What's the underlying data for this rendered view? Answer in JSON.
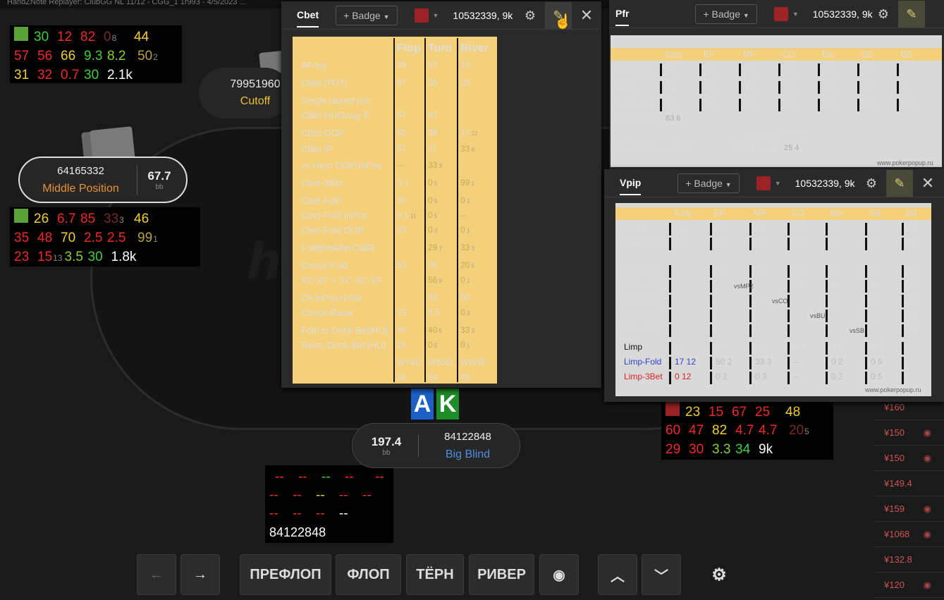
{
  "window_title": "HandZNote Replayer: ClubGG NL 11/12 - CGG_1 1r993 - 4/5/2023 ...",
  "watermark": "h",
  "hud_topleft": {
    "rows": [
      [
        {
          "t": "",
          "k": "sq"
        },
        {
          "t": "30",
          "c": "cG"
        },
        {
          "t": "12",
          "c": "cR"
        },
        {
          "t": "82",
          "c": "cR"
        },
        {
          "t": "0",
          "c": "cDR",
          "s": "8"
        },
        {
          "t": "44",
          "c": "cY"
        }
      ],
      [
        {
          "t": "57",
          "c": "cR"
        },
        {
          "t": "56",
          "c": "cR"
        },
        {
          "t": "66",
          "c": "cY"
        },
        {
          "t": "9.3",
          "c": "cG"
        },
        {
          "t": "8.2",
          "c": "cLG"
        },
        {
          "t": "50",
          "c": "cO",
          "s": "2"
        }
      ],
      [
        {
          "t": "31",
          "c": "cY"
        },
        {
          "t": "32",
          "c": "cR"
        },
        {
          "t": "0.7",
          "c": "cR"
        },
        {
          "t": "30",
          "c": "cG"
        },
        {
          "t": "2.1k",
          "c": "cW"
        }
      ]
    ]
  },
  "hud_mid": {
    "rows": [
      [
        {
          "t": "",
          "k": "sq"
        },
        {
          "t": "26",
          "c": "cY"
        },
        {
          "t": "6.7",
          "c": "cR"
        },
        {
          "t": "85",
          "c": "cR"
        },
        {
          "t": "33",
          "c": "cDR",
          "s": "3"
        },
        {
          "t": "46",
          "c": "cY"
        }
      ],
      [
        {
          "t": "35",
          "c": "cR"
        },
        {
          "t": "48",
          "c": "cR"
        },
        {
          "t": "70",
          "c": "cY"
        },
        {
          "t": "2.5",
          "c": "cR"
        },
        {
          "t": "2.5",
          "c": "cR"
        },
        {
          "t": "99",
          "c": "cO",
          "s": "1"
        }
      ],
      [
        {
          "t": "23",
          "c": "cR"
        },
        {
          "t": "15",
          "c": "cR",
          "s": "13"
        },
        {
          "t": "3.5",
          "c": "cLG"
        },
        {
          "t": "30",
          "c": "cG"
        },
        {
          "t": "1.8k",
          "c": "cW"
        }
      ]
    ]
  },
  "hud_right": {
    "rows": [
      [
        {
          "t": "",
          "k": "sq"
        },
        {
          "t": "23",
          "c": "cY"
        },
        {
          "t": "15",
          "c": "cR"
        },
        {
          "t": "67",
          "c": "cR"
        },
        {
          "t": "25",
          "c": "cR"
        },
        {
          "t": "48",
          "c": "cY"
        }
      ],
      [
        {
          "t": "60",
          "c": "cR"
        },
        {
          "t": "47",
          "c": "cR"
        },
        {
          "t": "82",
          "c": "cY"
        },
        {
          "t": "4.7",
          "c": "cR"
        },
        {
          "t": "4.7",
          "c": "cR"
        },
        {
          "t": "20",
          "c": "cDR",
          "s": "5"
        }
      ],
      [
        {
          "t": "29",
          "c": "cR"
        },
        {
          "t": "30",
          "c": "cR"
        },
        {
          "t": "3.3",
          "c": "cLG"
        },
        {
          "t": "34",
          "c": "cG"
        },
        {
          "t": "9k",
          "c": "cW"
        }
      ]
    ]
  },
  "hud_hero": {
    "rows": [
      [
        {
          "t": "",
          "k": "sq"
        },
        {
          "t": "--",
          "c": "cR"
        },
        {
          "t": "--",
          "c": "cR"
        },
        {
          "t": "--",
          "c": "cG"
        },
        {
          "t": "--",
          "c": "cR"
        },
        {
          "t": "--",
          "c": "cR"
        }
      ],
      [
        {
          "t": "--",
          "c": "cR"
        },
        {
          "t": "--",
          "c": "cR"
        },
        {
          "t": "--",
          "c": "cY"
        },
        {
          "t": "--",
          "c": "cR"
        },
        {
          "t": "--",
          "c": "cR"
        }
      ],
      [
        {
          "t": "--",
          "c": "cR"
        },
        {
          "t": "--",
          "c": "cR"
        },
        {
          "t": "--",
          "c": "cR"
        },
        {
          "t": "--",
          "c": "cW"
        }
      ]
    ],
    "name": "84122848"
  },
  "players": {
    "cutoff": {
      "id": "79951960",
      "pos": "Cutoff"
    },
    "mp": {
      "id": "64165332",
      "pos": "Middle Position",
      "stack": "67.7",
      "unit": "bb"
    },
    "hero": {
      "id": "84122848",
      "pos": "Big Blind",
      "stack": "197.4",
      "unit": "bb"
    }
  },
  "hero_cards": [
    "A",
    "K"
  ],
  "cbet_panel": {
    "tab": "Cbet",
    "badge": "+ Badge",
    "pid": "10532339, 9k",
    "headers": [
      "Flop",
      "Turn",
      "River"
    ],
    "rows": [
      {
        "l": "AFreq",
        "v": [
          "29",
          "21",
          "16"
        ]
      },
      {
        "l": "CBet [TOT]",
        "v": [
          "67",
          "36",
          "29"
        ]
      },
      {
        "l": "Single raised pot:",
        "v": [
          "",
          "",
          ""
        ]
      },
      {
        "l": "CBet HU/3way F",
        "v": [
          "67",
          "53",
          ""
        ]
      },
      {
        "l": "CBet OOP",
        "v": [
          "62",
          "38",
          "17 12"
        ]
      },
      {
        "l": "CBet IP",
        "v": [
          "67",
          "27",
          "33 6"
        ]
      },
      {
        "l": "vs Hero OOP/InPos",
        "v": [
          "--",
          "33 3",
          ""
        ]
      },
      {
        "l": "Cbet-3Bet",
        "v": [
          "3.1",
          "0 5",
          "99 1"
        ]
      },
      {
        "l": "Cbet-Fold",
        "v": [
          "20",
          "0 5",
          "0 1"
        ]
      },
      {
        "l": "Cbet-Fold InPos",
        "v": [
          "9.1 11",
          "0 5",
          "--"
        ]
      },
      {
        "l": "Cbet-Fold OOP",
        "v": [
          "33",
          "0 3",
          "0 1"
        ]
      },
      {
        "l": "FoldBetAfterCallR",
        "v": [
          "",
          "29 7",
          "33 3"
        ]
      },
      {
        "l": "Check-Fold",
        "v": [
          "53",
          "26",
          "20 5"
        ]
      },
      {
        "l": "XC-XF + XC-XC-XF",
        "v": [
          "",
          "56 9",
          "0 1"
        ]
      },
      {
        "l": "Ch inPos+Fold",
        "v": [
          "",
          "62",
          "60"
        ]
      },
      {
        "l": "Check-Raise",
        "v": [
          "19",
          "6.5",
          "0 3"
        ]
      },
      {
        "l": "Fold to Donk Bet[HU]",
        "v": [
          "45",
          "40 5",
          "33 3"
        ]
      },
      {
        "l": "Raise Donk Bet [HU]",
        "v": [
          "15",
          "0 5",
          "0 1"
        ]
      }
    ],
    "foot_headers": [
      "WTSD",
      "W$SD",
      "WWSF"
    ],
    "foot_values": [
      "34",
      "54",
      "40"
    ]
  },
  "pfr_panel": {
    "tab": "Pfr",
    "badge": "+ Badge",
    "pid": "10532339, 9k",
    "headers": [
      "Total",
      "EP",
      "MP",
      "CO",
      "Btn",
      "SB",
      "BB"
    ],
    "rows": [
      {
        "l": "Raise 1st",
        "v": [
          "24",
          "23",
          "22",
          "26",
          "27",
          "32",
          ""
        ]
      },
      {
        "l": "PFR",
        "v": [
          "6.2",
          "22",
          "17",
          "16",
          "13",
          "11",
          "6"
        ]
      },
      {
        "l": "IsOR vs 1",
        "v": [
          "17",
          "20",
          "16",
          "20",
          "17",
          "16",
          "12"
        ]
      }
    ],
    "isor_fold": "IsOR/Fold",
    "isor_fold_v": "83 6",
    "sb_steal": "SB Steal",
    "sb_steal_v": "17 12",
    "steal_hero": "StealVsHero on BB",
    "btn_steal": "BTN Steal",
    "btn_steal_v": "25 4",
    "site": "www.pokerpopup.ru"
  },
  "vpip_panel": {
    "tab": "Vpip",
    "badge": "+ Badge",
    "pid": "10532339, 9k",
    "headers": [
      "Total",
      "EP",
      "MP",
      "CO",
      "Btn",
      "SB",
      "BB"
    ],
    "rows": [
      {
        "l": "VP$IP",
        "v": [
          "20",
          "23",
          "21",
          "22",
          "21",
          "21",
          "31"
        ]
      },
      {
        "l": "Call Open",
        "v": [
          "19",
          "14",
          "15",
          "13",
          "15",
          "13",
          "39"
        ]
      }
    ],
    "cc_rows": [
      {
        "l": "CCvsEP",
        "v": [
          "",
          "14",
          "15",
          "13",
          "17",
          "11",
          "38"
        ]
      },
      {
        "l": "CCvsMP",
        "v": [
          "",
          "",
          "vsMP2",
          "12",
          "14",
          "16",
          "35"
        ]
      },
      {
        "l": "CCvsCO",
        "v": [
          "",
          "",
          "",
          "vsCO",
          "14",
          "15",
          "42"
        ]
      },
      {
        "l": "CCvsBU",
        "v": [
          "",
          "",
          "",
          "",
          "vsBU",
          "12",
          "34"
        ]
      },
      {
        "l": "CCvsSB",
        "v": [
          "",
          "",
          "",
          "",
          "",
          "vsSB",
          "44"
        ]
      }
    ],
    "limp_rows": [
      {
        "l": "Limp",
        "c": "#111",
        "v": [
          "0",
          "0.2",
          "0.4",
          "0.4",
          "0.5",
          "1.5",
          ""
        ]
      },
      {
        "l": "Limp-Fold",
        "c": "#3344cc",
        "v": [
          "17 12",
          "50 2",
          "33 3",
          "--",
          "0 2",
          "0 5",
          ""
        ]
      },
      {
        "l": "Limp-3Bet",
        "c": "#dd2222",
        "v": [
          "0 12",
          "0 2",
          "0 3",
          "--",
          "0 2",
          "0 5",
          ""
        ]
      }
    ],
    "site": "www.pokerpopup.ru"
  },
  "side_amounts": [
    "¥160",
    "¥150",
    "¥150",
    "¥149.4",
    "¥159",
    "¥1068",
    "¥132.8",
    "¥120"
  ],
  "controls": {
    "prev": "←",
    "next": "→",
    "preflop": "ПРЕФЛОП",
    "flop": "ФЛОП",
    "turn": "ТЁРН",
    "river": "РИВЕР",
    "eye": "◉",
    "up": "︿",
    "down": "﹀",
    "gear": "⚙"
  },
  "colors": {
    "accent_orange": "#e8913a",
    "bb_blue": "#4d8fe0",
    "panel_bg": "#f4d07a",
    "hud_square": "#5aa13a",
    "red_square": "#9b2226"
  }
}
